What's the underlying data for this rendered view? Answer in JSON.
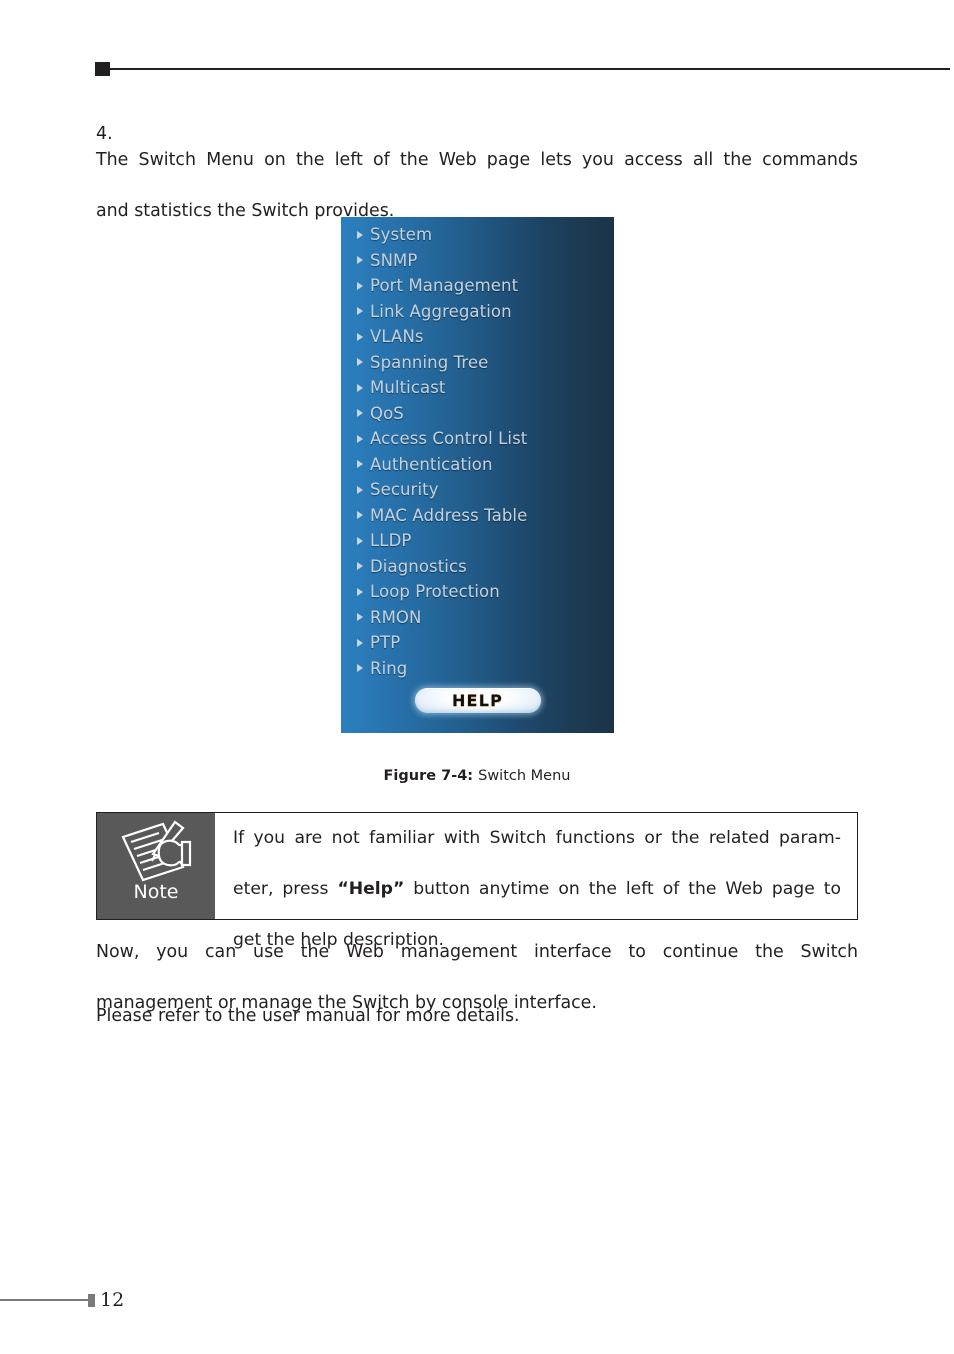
{
  "page": {
    "number": "12"
  },
  "step": {
    "number": "4.",
    "line1": "The Switch Menu on the left of the Web page lets you access all the commands",
    "line2": "and statistics the Switch provides."
  },
  "switch_menu": {
    "items": [
      {
        "label": "System"
      },
      {
        "label": "SNMP"
      },
      {
        "label": "Port Management"
      },
      {
        "label": "Link Aggregation"
      },
      {
        "label": "VLANs"
      },
      {
        "label": "Spanning Tree"
      },
      {
        "label": "Multicast"
      },
      {
        "label": "QoS"
      },
      {
        "label": "Access Control List"
      },
      {
        "label": "Authentication"
      },
      {
        "label": "Security"
      },
      {
        "label": "MAC Address Table"
      },
      {
        "label": "LLDP"
      },
      {
        "label": "Diagnostics"
      },
      {
        "label": "Loop Protection"
      },
      {
        "label": "RMON"
      },
      {
        "label": "PTP"
      },
      {
        "label": "Ring"
      }
    ],
    "help_button_label": "HELP",
    "colors": {
      "gradient_left": "#2a7fbe",
      "gradient_right": "#1b3447",
      "item_text": "#c6d3df",
      "arrow": "#c9d6e2"
    }
  },
  "figure": {
    "number": "Figure 7-4:",
    "title": "Switch Menu"
  },
  "note": {
    "icon_label": "Note",
    "line1": "If you are not familiar with Switch functions or the related param-",
    "line2_a": "eter, press ",
    "line2_bold": "“Help”",
    "line2_b": " button anytime on the left of the Web page to",
    "line3": "get the help description.",
    "panel_color": "#595959"
  },
  "paragraphs": {
    "p1_line1": "Now, you can use the Web management interface to continue the Switch",
    "p1_line2": "management or manage the Switch by console interface.",
    "p2": "Please refer to the user manual for more details."
  }
}
